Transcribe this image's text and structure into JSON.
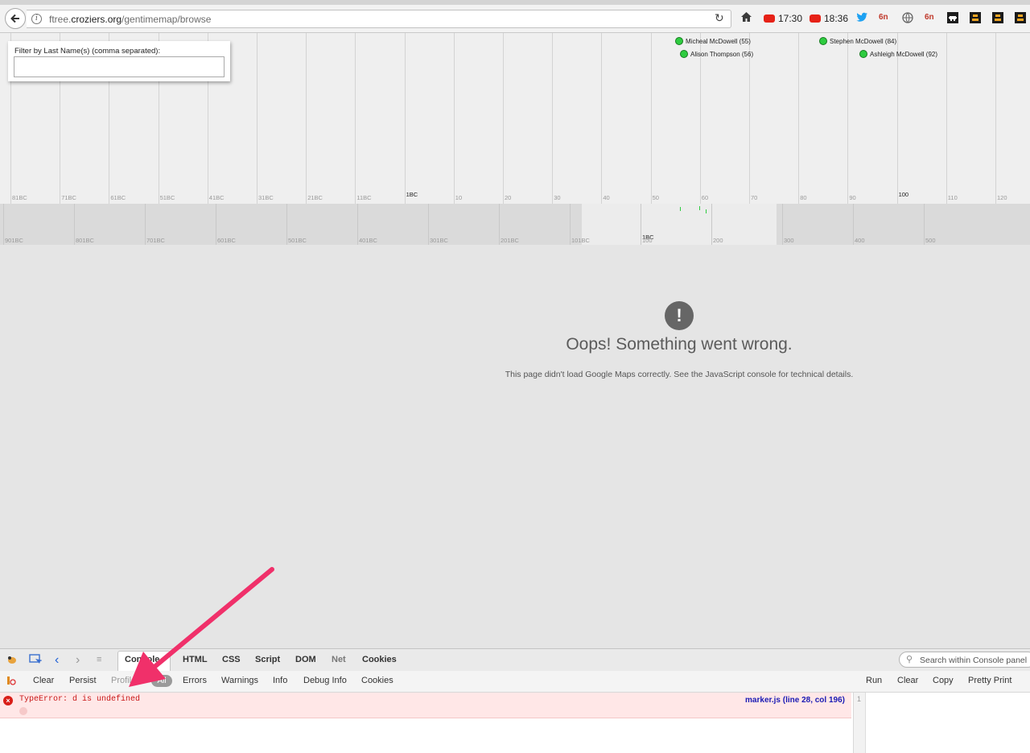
{
  "browser": {
    "url_prefix": "ftree.",
    "url_domain": "croziers.org",
    "url_path": "/gentimemap/browse",
    "toolbar": {
      "yt1": "17:30",
      "yt2": "18:36",
      "badge": "6n"
    }
  },
  "timeline": {
    "filter_label": "Filter by Last Name(s) (comma separated):",
    "filter_value": "",
    "markers": [
      "Micheal McDowell (55)",
      "Alison Thompson (56)",
      "Stephen McDowell (84)",
      "Ashleigh McDowell (92)"
    ],
    "top_ticks": [
      "81BC",
      "71BC",
      "61BC",
      "51BC",
      "41BC",
      "31BC",
      "21BC",
      "11BC",
      "1BC",
      "10",
      "20",
      "30",
      "40",
      "50",
      "60",
      "70",
      "80",
      "90",
      "100",
      "110",
      "120"
    ],
    "bottom_ticks": [
      "901BC",
      "801BC",
      "701BC",
      "601BC",
      "501BC",
      "401BC",
      "301BC",
      "201BC",
      "101BC",
      "1BC",
      "100",
      "200",
      "300",
      "400",
      "500"
    ]
  },
  "map_error": {
    "icon": "!",
    "title": "Oops! Something went wrong.",
    "message": "This page didn't load Google Maps correctly. See the JavaScript console for technical details."
  },
  "firebug": {
    "tabs": [
      "Console",
      "HTML",
      "CSS",
      "Script",
      "DOM",
      "Net",
      "Cookies"
    ],
    "search_placeholder": "Search within Console panel",
    "filters": {
      "clear": "Clear",
      "persist": "Persist",
      "profile": "Profile",
      "all": "All",
      "errors": "Errors",
      "warnings": "Warnings",
      "info": "Info",
      "debug": "Debug Info",
      "cookies": "Cookies"
    },
    "right_buttons": {
      "run": "Run",
      "clear": "Clear",
      "copy": "Copy",
      "pretty": "Pretty Print"
    },
    "error": {
      "text": "TypeError: d is undefined",
      "location": "marker.js (line 28, col 196)"
    },
    "line_number": "1"
  },
  "colors": {
    "error": "#c81717",
    "arrow": "#f0306a",
    "marker": "#2ecc40"
  }
}
